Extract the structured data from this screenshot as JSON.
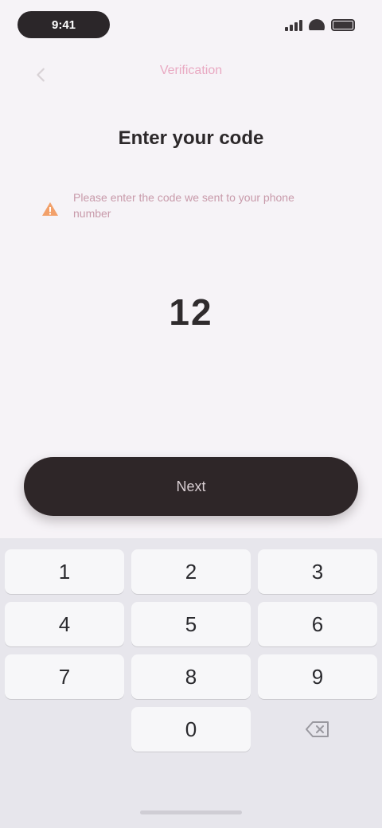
{
  "status_bar": {
    "time": "9:41"
  },
  "nav": {
    "title": "Verification"
  },
  "heading": "Enter your code",
  "notice": {
    "text": "Please enter the code we sent to your phone number"
  },
  "code": {
    "value": "12"
  },
  "primary_button": {
    "label": "Next"
  },
  "keypad": {
    "keys": [
      "1",
      "2",
      "3",
      "4",
      "5",
      "6",
      "7",
      "8",
      "9",
      "0"
    ]
  },
  "colors": {
    "accent": "#e9a9c2",
    "button_dark": "#2e2628",
    "background": "#f6f3f7"
  }
}
